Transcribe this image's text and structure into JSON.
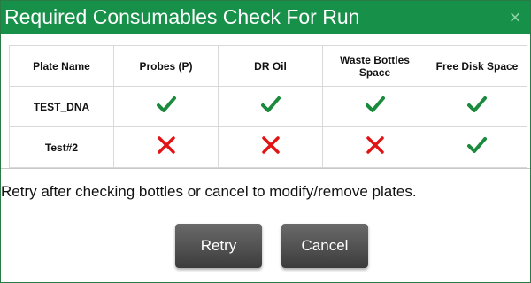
{
  "dialog": {
    "title": "Required Consumables Check For Run",
    "close_glyph": "×",
    "colors": {
      "titlebar": "#17914a",
      "check": "#1a8a3c",
      "cross": "#e01414",
      "button": "#4f4f4f"
    }
  },
  "table": {
    "headers": [
      "Plate Name",
      "Probes (P)",
      "DR Oil",
      "Waste Bottles Space",
      "Free Disk Space"
    ],
    "rows": [
      {
        "name": "TEST_DNA",
        "statuses": [
          "check-icon",
          "check-icon",
          "check-icon",
          "check-icon"
        ]
      },
      {
        "name": "Test#2",
        "statuses": [
          "cross-icon",
          "cross-icon",
          "cross-icon",
          "check-icon"
        ]
      }
    ]
  },
  "message": "Retry after checking bottles or cancel to modify/remove plates.",
  "buttons": {
    "retry": "Retry",
    "cancel": "Cancel"
  }
}
